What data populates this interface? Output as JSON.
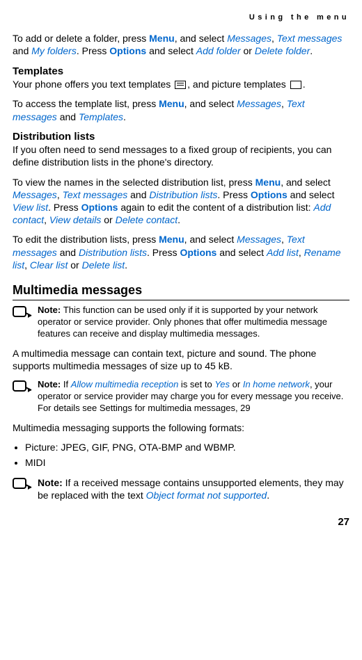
{
  "header": "Using the menu",
  "para1": {
    "t1": "To add or delete a folder, press ",
    "menu": "Menu",
    "t2": ", and select ",
    "messages": "Messages",
    "t3": ", ",
    "textmsg": "Text messages",
    "t4": " and ",
    "myfolders": "My folders",
    "t5": ". Press ",
    "options": "Options",
    "t6": " and select ",
    "addfolder": "Add folder",
    "t7": " or ",
    "deletefolder": "Delete folder",
    "t8": "."
  },
  "templates": {
    "heading": "Templates",
    "line1a": "Your phone offers you text templates ",
    "line1b": ", and picture templates ",
    "line1c": ".",
    "line2a": "To access the template list, press ",
    "menu": "Menu",
    "line2b": ", and select ",
    "messages": "Messages",
    "line2c": ", ",
    "textmsg": "Text messages",
    "line2d": " and ",
    "templates": "Templates",
    "line2e": "."
  },
  "distlists": {
    "heading": "Distribution lists",
    "p1": "If you often need to send messages to a fixed group of recipients, you can define distribution lists in the phone's directory.",
    "p2a": "To view the names in the selected distribution list, press ",
    "menu": "Menu",
    "p2b": ", and select ",
    "messages": "Messages",
    "p2c": ", ",
    "textmsg": "Text messages",
    "p2d": " and ",
    "distlists": "Distribution lists",
    "p2e": ". Press ",
    "options": "Options",
    "p2f": " and select ",
    "viewlist": "View list",
    "p2g": ". Press ",
    "options2": "Options",
    "p2h": " again to edit the content of a distribution list: ",
    "addcontact": "Add contact",
    "p2i": ", ",
    "viewdetails": "View details",
    "p2j": " or ",
    "deletecontact": "Delete contact",
    "p2k": ".",
    "p3a": "To edit the distribution lists, press ",
    "p3menu": "Menu",
    "p3b": ", and select ",
    "p3messages": "Messages",
    "p3c": ", ",
    "p3textmsg": "Text messages",
    "p3d": " and ",
    "p3distlists": "Distribution lists",
    "p3e": ". Press ",
    "p3options": "Options",
    "p3f": " and select ",
    "addlist": "Add list",
    "p3g": ", ",
    "renamelist": "Rename list",
    "p3h": ", ",
    "clearlist": "Clear list",
    "p3i": " or ",
    "deletelist": "Delete list",
    "p3j": "."
  },
  "mms": {
    "heading": "Multimedia messages",
    "note1label": "Note: ",
    "note1": "This function can be used only if it is supported by your network operator or service provider. Only phones that offer multimedia message features can receive and display multimedia messages.",
    "p1": "A multimedia message can contain text, picture and sound. The phone supports multimedia messages of size up to 45 kB.",
    "note2label": "Note: ",
    "note2a": "If ",
    "allowmr": "Allow multimedia reception",
    "note2b": " is set to ",
    "yes": "Yes",
    "note2c": " or ",
    "inhome": "In home network",
    "note2d": ", your operator or service provider may charge you for every message you receive. For details see Settings for multimedia messages, 29",
    "p2": "Multimedia messaging supports the following formats:",
    "li1": "Picture: JPEG, GIF, PNG, OTA-BMP and WBMP.",
    "li2": "MIDI",
    "note3label": "Note: ",
    "note3a": "If a received message contains unsupported elements, they may be replaced with the text ",
    "objfmt": "Object format not supported",
    "note3b": "."
  },
  "page": "27"
}
